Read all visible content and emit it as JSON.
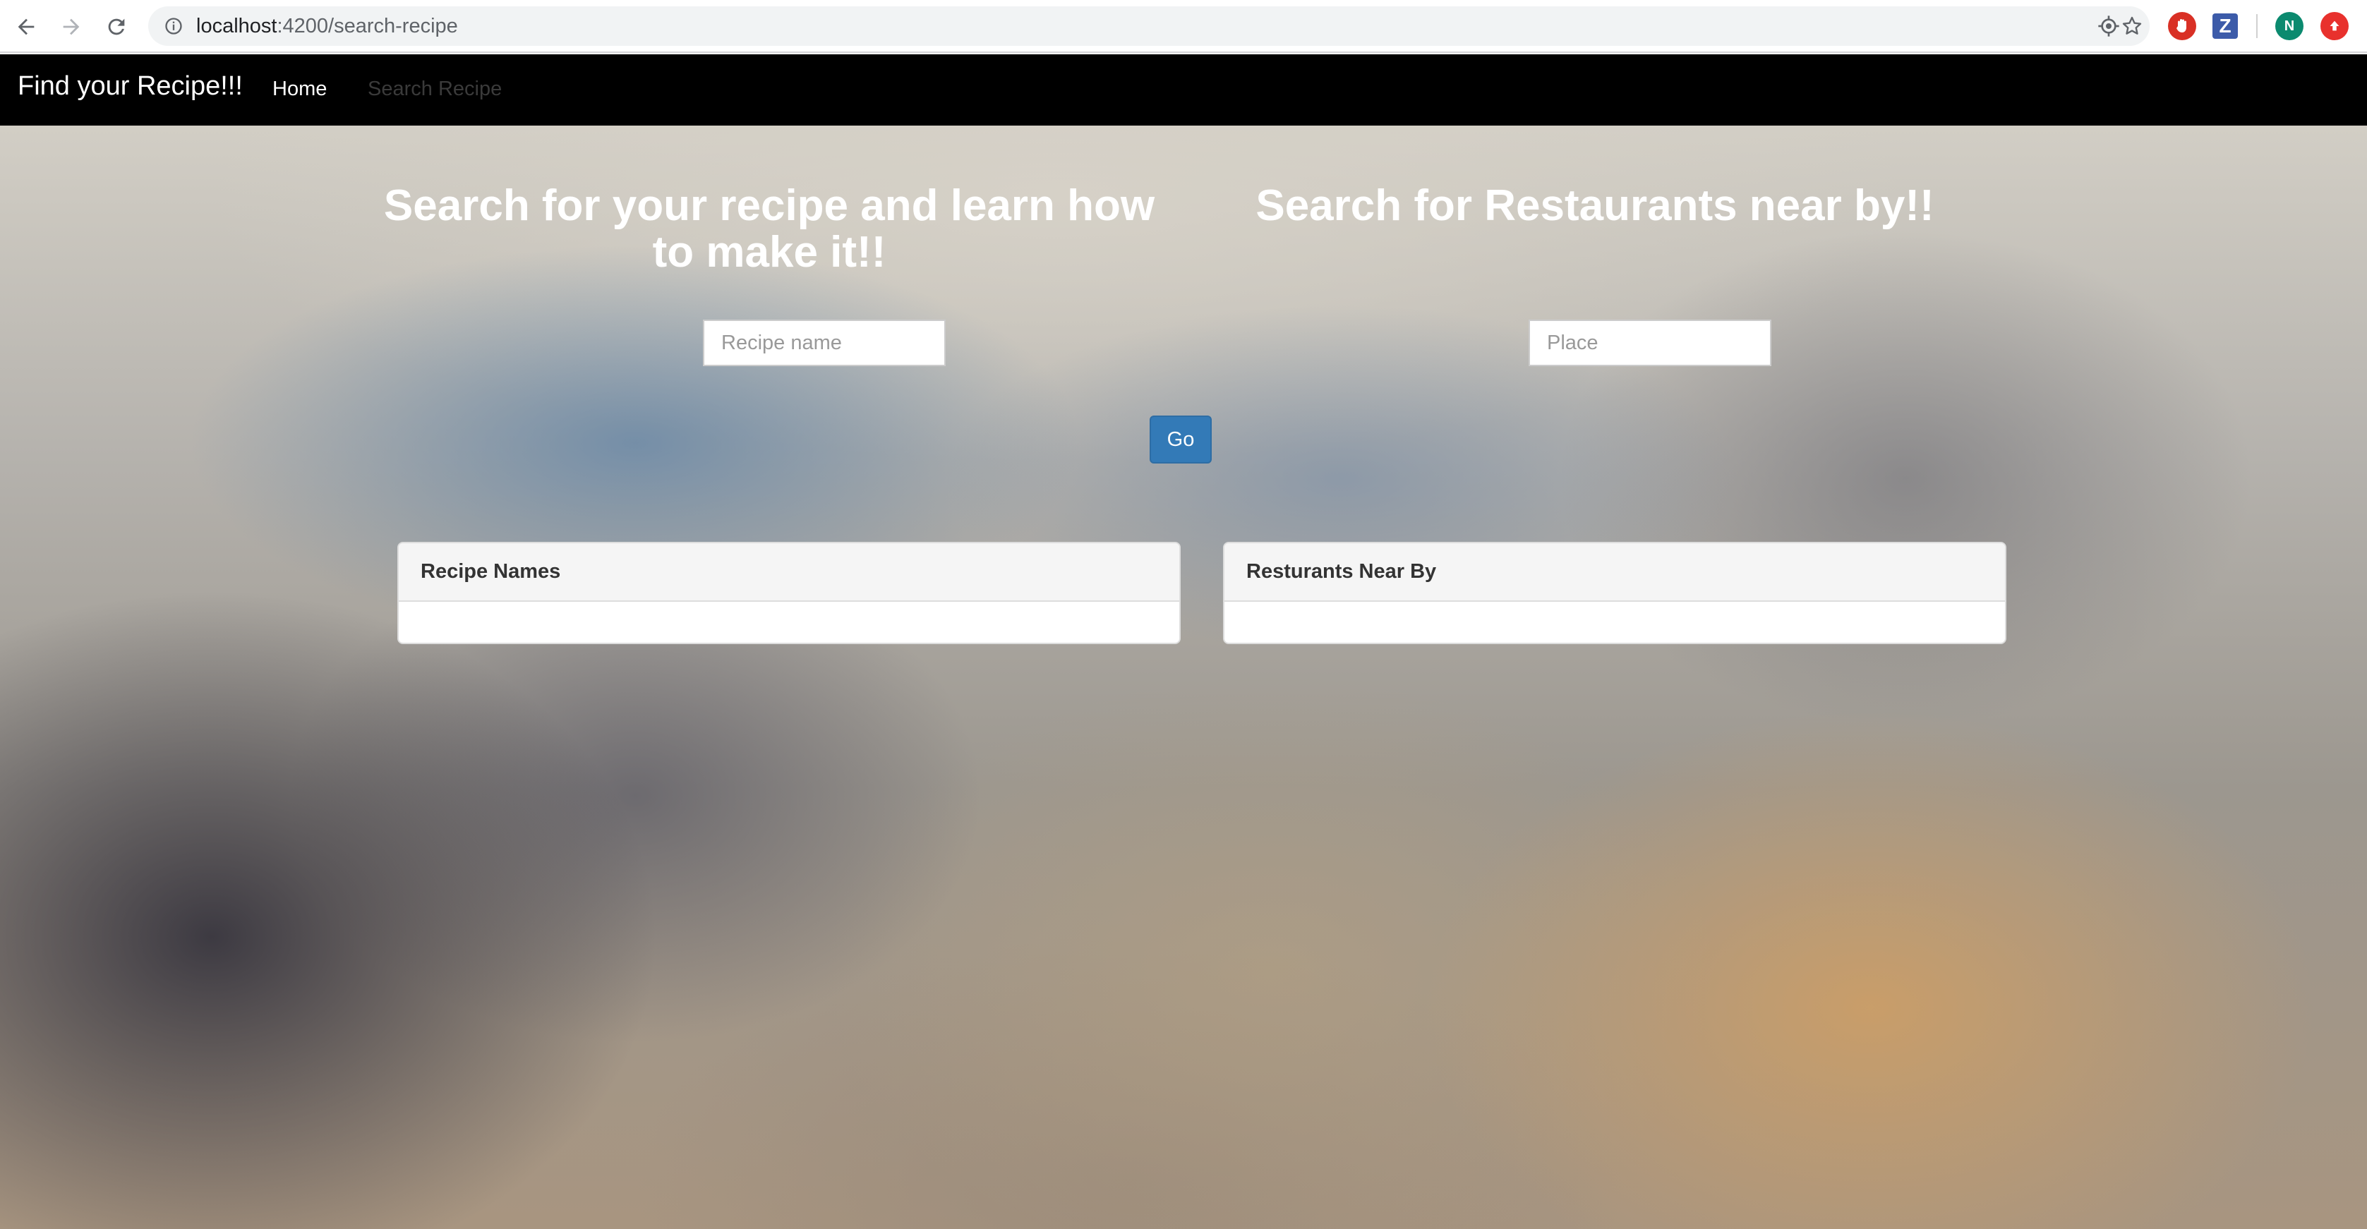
{
  "browser": {
    "url_host": "localhost",
    "url_path": ":4200/search-recipe",
    "profile_initial": "N",
    "icons": [
      "back-icon",
      "forward-icon",
      "reload-icon",
      "info-icon",
      "location-icon",
      "star-icon",
      "extension-red-icon",
      "extension-z-icon",
      "profile-avatar",
      "extension-upload-icon"
    ]
  },
  "navbar": {
    "brand": "Find your Recipe!!!",
    "links": [
      {
        "label": "Home",
        "active": true
      },
      {
        "label": "Search Recipe",
        "active": false
      }
    ]
  },
  "recipe_section": {
    "title": "Search for your recipe and learn how to make it!!",
    "input_placeholder": "Recipe name",
    "input_value": ""
  },
  "restaurant_section": {
    "title": "Search for Restaurants near by!!",
    "input_placeholder": "Place",
    "input_value": ""
  },
  "go_button": "Go",
  "panels": {
    "recipes": {
      "heading": "Recipe Names",
      "items": []
    },
    "restaurants": {
      "heading": "Resturants Near By",
      "items": []
    }
  },
  "colors": {
    "navbar_bg": "#000000",
    "primary_button": "#337ab7",
    "panel_heading_bg": "#f5f5f5"
  }
}
